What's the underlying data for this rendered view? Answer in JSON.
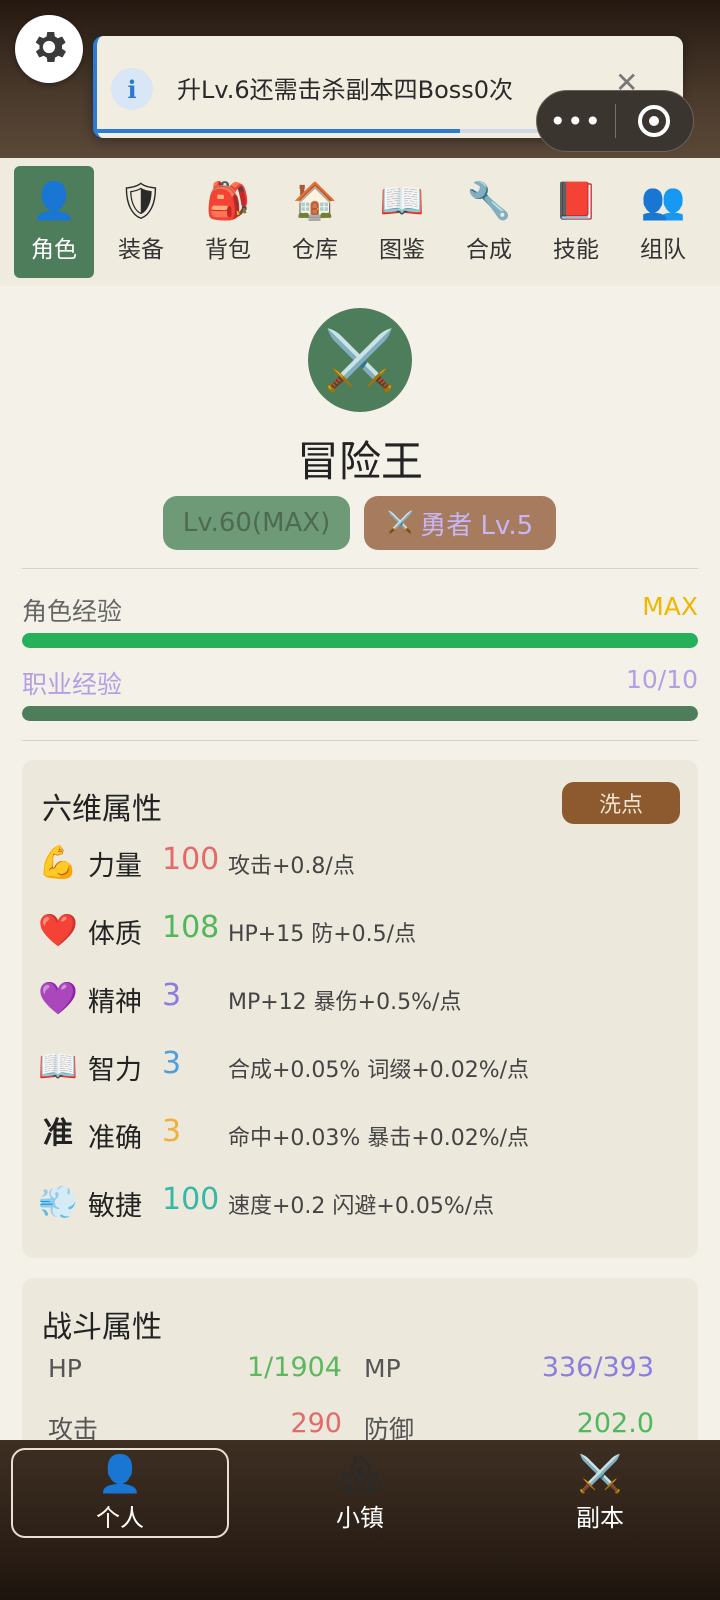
{
  "header": {
    "toast": {
      "text": "升Lv.6还需击杀副本四Boss0次",
      "progress": 0.62
    },
    "capsule": {
      "more_label": "•••"
    }
  },
  "tabs": [
    {
      "label": "角色",
      "icon": "person-icon",
      "glyph": "👤",
      "active": true
    },
    {
      "label": "装备",
      "icon": "shield-icon",
      "glyph": "🛡",
      "active": false
    },
    {
      "label": "背包",
      "icon": "backpack-icon",
      "glyph": "🎒",
      "active": false
    },
    {
      "label": "仓库",
      "icon": "house-icon",
      "glyph": "🏠",
      "active": false
    },
    {
      "label": "图鉴",
      "icon": "book-icon",
      "glyph": "📖",
      "active": false
    },
    {
      "label": "合成",
      "icon": "wrench-icon",
      "glyph": "🔧",
      "active": false
    },
    {
      "label": "技能",
      "icon": "skill-book-icon",
      "glyph": "📕",
      "active": false
    },
    {
      "label": "组队",
      "icon": "team-icon",
      "glyph": "👥",
      "active": false
    }
  ],
  "profile": {
    "avatar_glyph": "⚔️",
    "name": "冒险王",
    "level_badge": "Lv.60(MAX)",
    "class_badge": "勇者 Lv.5",
    "class_glyph": "⚔️"
  },
  "exp": {
    "character": {
      "label": "角色经验",
      "value": "MAX",
      "fill": 1.0,
      "color": "#27b05a"
    },
    "job": {
      "label": "职业经验",
      "value": "10/10",
      "fill": 1.0,
      "color": "#4e7d5c"
    }
  },
  "attributes": {
    "title": "六维属性",
    "reset_label": "洗点",
    "rows": [
      {
        "icon": "muscle-icon",
        "glyph": "💪",
        "name": "力量",
        "value": "100",
        "color": "#e36a6a",
        "desc": "攻击+0.8/点"
      },
      {
        "icon": "heart-icon",
        "glyph": "❤️",
        "name": "体质",
        "value": "108",
        "color": "#4fb85c",
        "desc": "HP+15 防+0.5/点"
      },
      {
        "icon": "purple-heart-icon",
        "glyph": "💜",
        "name": "精神",
        "value": "3",
        "color": "#8a7de0",
        "desc": "MP+12 暴伤+0.5%/点"
      },
      {
        "icon": "book-icon",
        "glyph": "📖",
        "name": "智力",
        "value": "3",
        "color": "#4da0e0",
        "desc": "合成+0.05% 词缀+0.02%/点"
      },
      {
        "icon": "zhun-glyph-icon",
        "glyph": "准",
        "name": "准确",
        "value": "3",
        "color": "#f0b13c",
        "desc": "命中+0.03% 暴击+0.02%/点"
      },
      {
        "icon": "wind-icon",
        "glyph": "💨",
        "name": "敏捷",
        "value": "100",
        "color": "#35b9a6",
        "desc": "速度+0.2 闪避+0.05%/点"
      }
    ]
  },
  "combat": {
    "title": "战斗属性",
    "rows": [
      {
        "left_label": "HP",
        "left_value": "1/1904",
        "left_color": "#5cb85c",
        "right_label": "MP",
        "right_value": "336/393",
        "right_color": "#8a7de0"
      },
      {
        "left_label": "攻击",
        "left_value": "290",
        "left_color": "#e36a6a",
        "right_label": "防御",
        "right_value": "202.0",
        "right_color": "#4fb85c"
      }
    ]
  },
  "bottom_nav": [
    {
      "label": "个人",
      "icon": "person-icon",
      "glyph": "👤",
      "active": true
    },
    {
      "label": "小镇",
      "icon": "town-icon",
      "glyph": "🏘",
      "active": false
    },
    {
      "label": "副本",
      "icon": "swords-icon",
      "glyph": "⚔️",
      "active": false
    }
  ]
}
